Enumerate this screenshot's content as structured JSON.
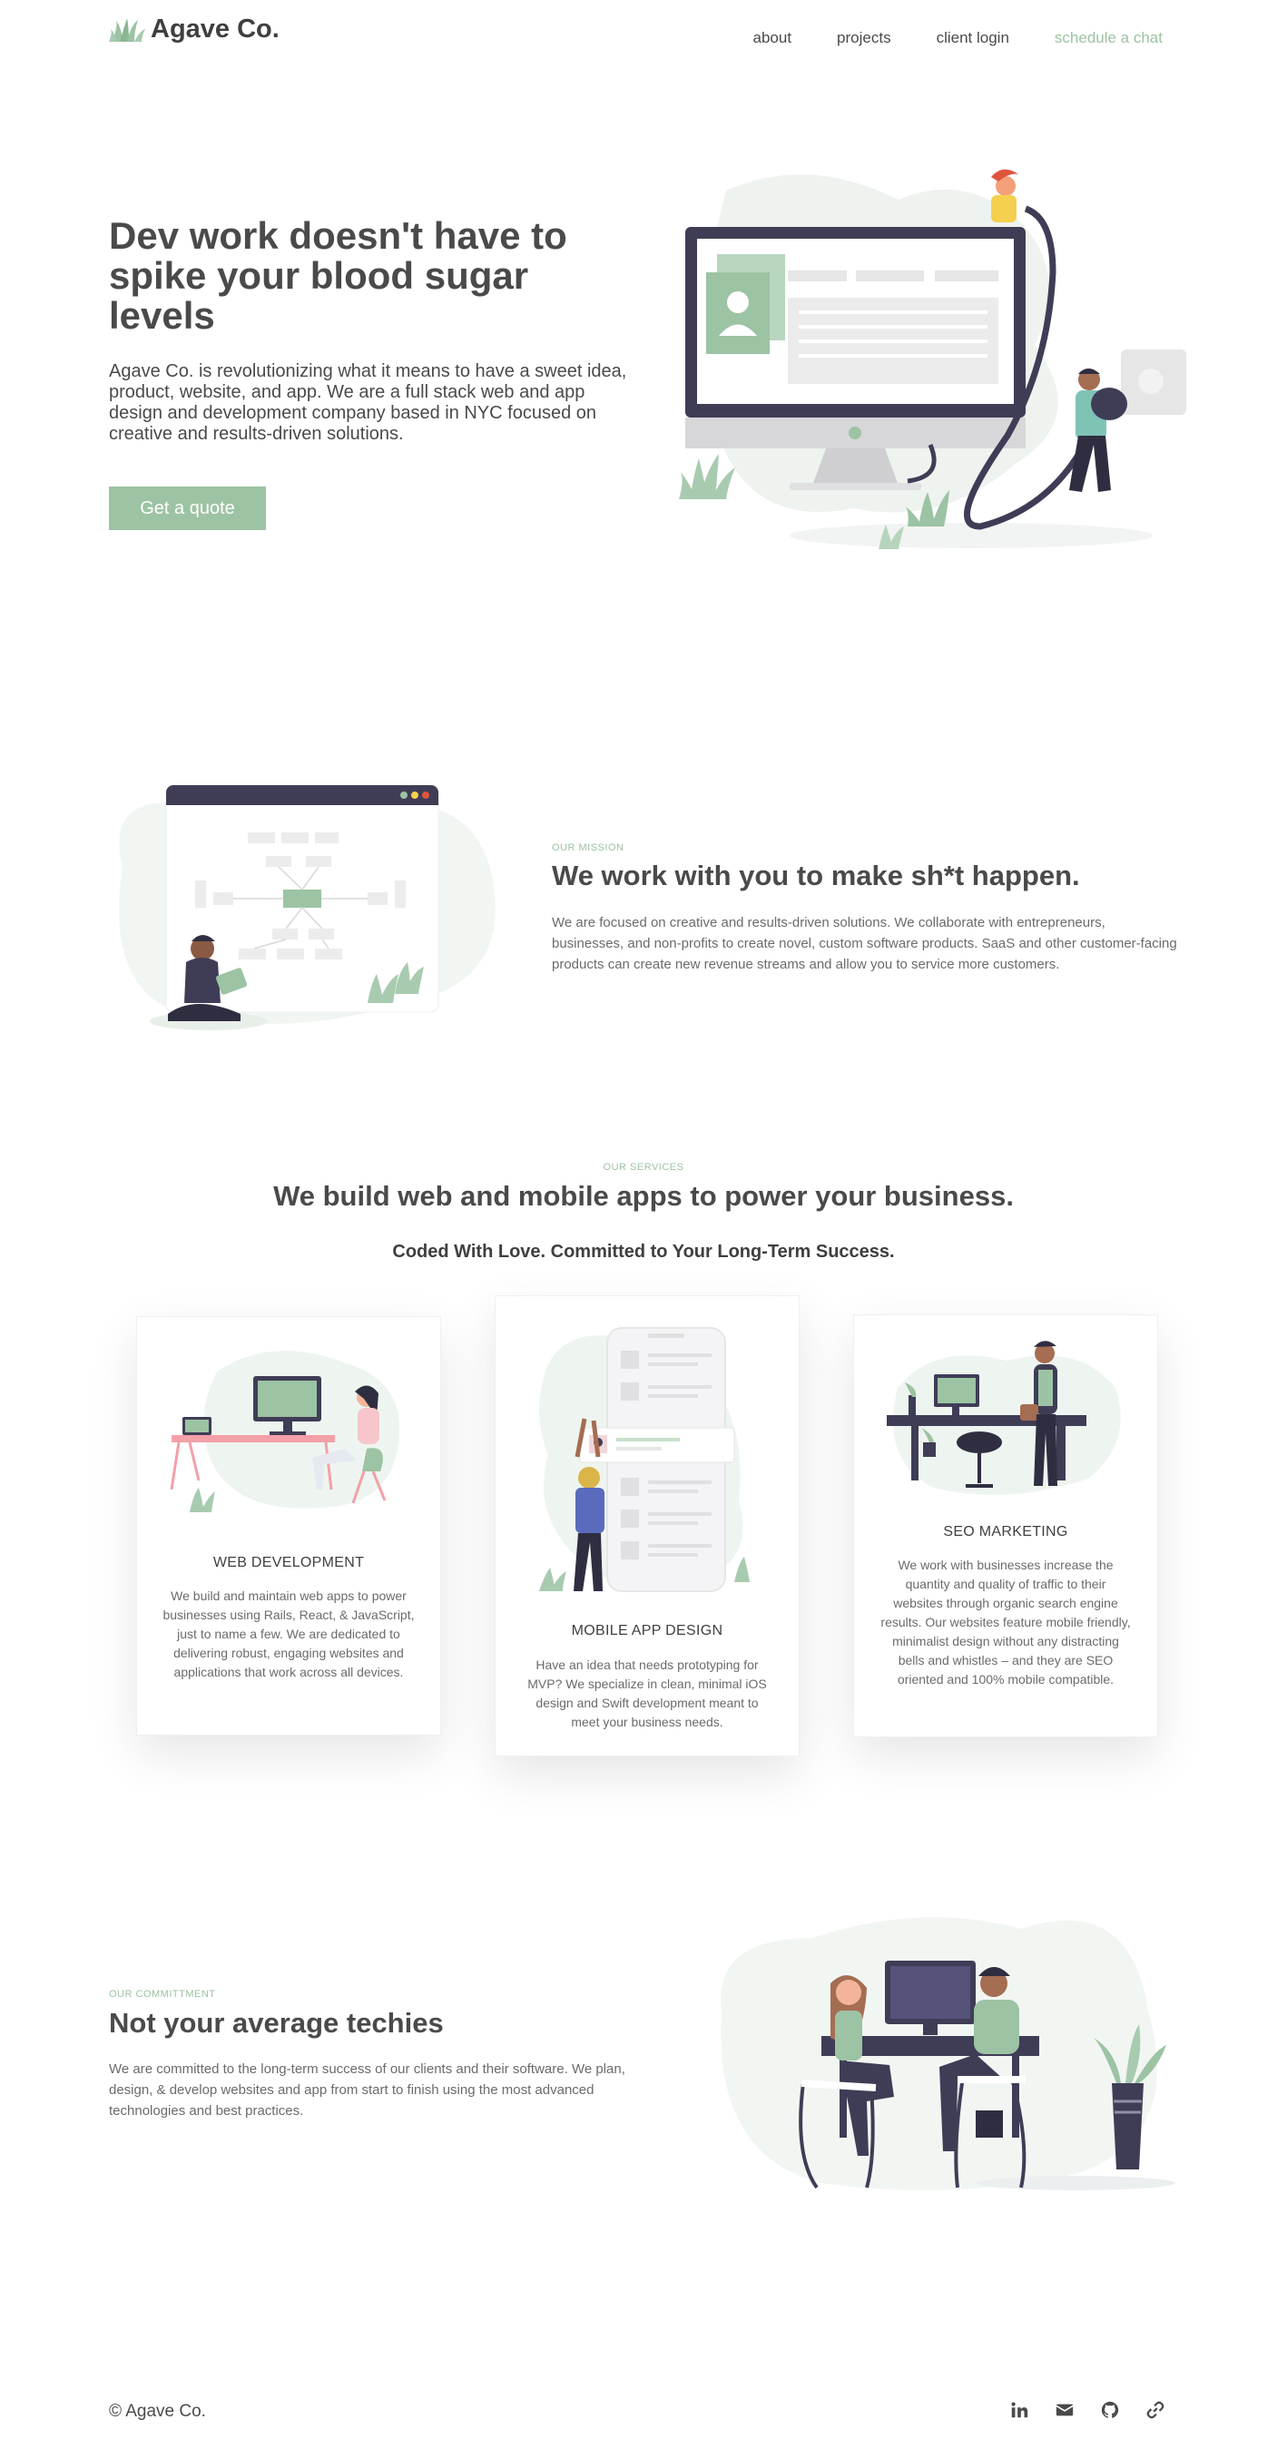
{
  "brand": {
    "name": "Agave Co.",
    "accent": "#9cc3a3",
    "dark": "#3f3d56"
  },
  "nav": {
    "about": "about",
    "projects": "projects",
    "client_login": "client login",
    "schedule": "schedule a chat"
  },
  "hero": {
    "title": "Dev work doesn't have to spike your blood sugar levels",
    "description": "Agave Co. is revolutionizing what it means to have a sweet idea, product, website, and app. We are a full stack web and app design and development company based in NYC focused on creative and results-driven solutions.",
    "cta": "Get a quote"
  },
  "mission": {
    "eyebrow": "OUR MISSION",
    "title": "We work with you to make sh*t happen.",
    "body": "We are focused on creative and results-driven solutions. We collaborate with entrepreneurs, businesses, and non-profits to create novel, custom software products. SaaS and other customer-facing products can create new revenue streams and allow you to service more customers."
  },
  "services": {
    "eyebrow": "OUR SERVICES",
    "title": "We build web and mobile apps to power your business.",
    "subtitle": "Coded With Love. Committed to Your Long-Term Success.",
    "cards": [
      {
        "title": "WEB DEVELOPMENT",
        "body": "We build and maintain web apps to power businesses using Rails, React, & JavaScript, just to name a few. We are dedicated to delivering robust, engaging websites and applications that work across all devices."
      },
      {
        "title": "MOBILE APP DESIGN",
        "body": "Have an idea that needs prototyping for MVP? We specialize in clean, minimal iOS design and Swift development meant to meet your business needs."
      },
      {
        "title": "SEO MARKETING",
        "body": "We work with businesses increase the quantity and quality of traffic to their websites through organic search engine results. Our websites feature mobile friendly, minimalist design without any distracting bells and whistles – and they are SEO oriented and 100% mobile compatible."
      }
    ]
  },
  "commitment": {
    "eyebrow": "OUR COMMITTMENT",
    "title": "Not your average techies",
    "body": "We are committed to the long-term success of our clients and their software. We plan, design, & develop websites and app from start to finish using the most advanced technologies and best practices."
  },
  "footer": {
    "copyright": "© Agave Co.",
    "icons": [
      "linkedin-icon",
      "envelope-icon",
      "github-icon",
      "link-icon"
    ]
  }
}
